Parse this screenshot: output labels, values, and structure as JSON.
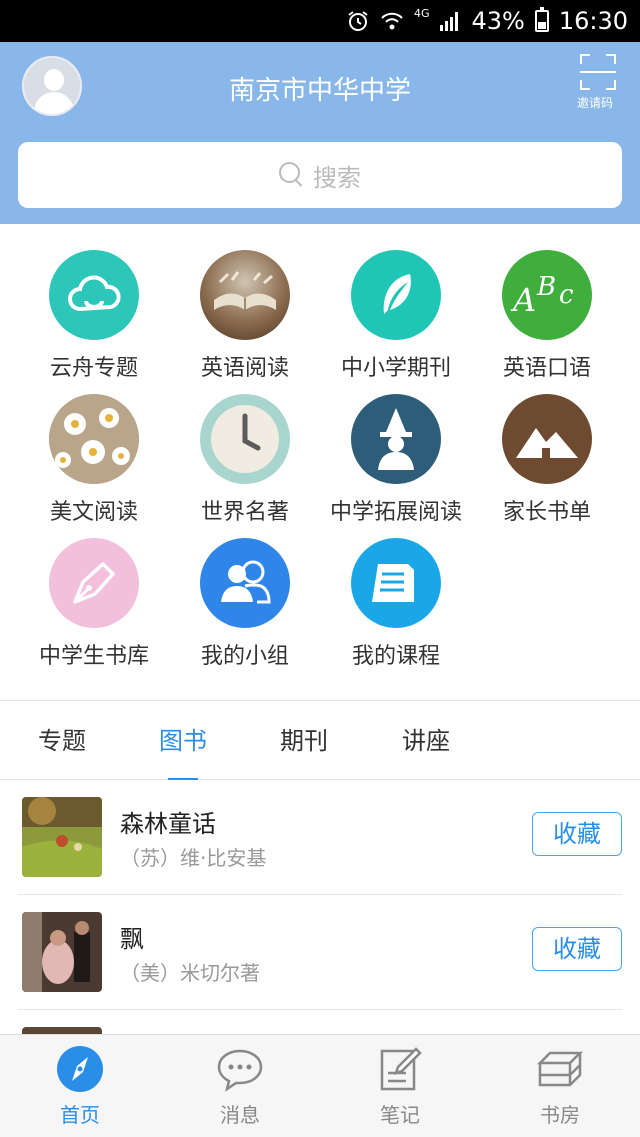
{
  "status_bar": {
    "network": "4G",
    "battery": "43%",
    "time": "16:30"
  },
  "header": {
    "title": "南京市中华中学",
    "invite_label": "邀请码",
    "search_placeholder": "搜索"
  },
  "grid": [
    {
      "label": "云舟专题",
      "icon": "cloud-icon",
      "color": "#2cc7b9"
    },
    {
      "label": "英语阅读",
      "icon": "open-book-icon",
      "color": "#6b4a2f"
    },
    {
      "label": "中小学期刊",
      "icon": "feather-icon",
      "color": "#1fc6b5"
    },
    {
      "label": "英语口语",
      "icon": "abc-icon",
      "color": "#3fae3c"
    },
    {
      "label": "美文阅读",
      "icon": "daisy-icon",
      "color": "#c9b89c"
    },
    {
      "label": "世界名著",
      "icon": "clock-icon",
      "color": "#a9d5cf"
    },
    {
      "label": "中学拓展阅读",
      "icon": "wizard-icon",
      "color": "#2d5d79"
    },
    {
      "label": "家长书单",
      "icon": "mountain-icon",
      "color": "#6e4b30"
    },
    {
      "label": "中学生书库",
      "icon": "pen-nib-icon",
      "color": "#f2bfdc"
    },
    {
      "label": "我的小组",
      "icon": "group-icon",
      "color": "#2f86e8"
    },
    {
      "label": "我的课程",
      "icon": "document-icon",
      "color": "#1aa7e8"
    }
  ],
  "tabs": [
    {
      "label": "专题",
      "active": false
    },
    {
      "label": "图书",
      "active": true
    },
    {
      "label": "期刊",
      "active": false
    },
    {
      "label": "讲座",
      "active": false
    }
  ],
  "books": [
    {
      "title": "森林童话",
      "author": "（苏）维·比安基",
      "button": "收藏"
    },
    {
      "title": "飘",
      "author": "（美）米切尔著",
      "button": "收藏"
    }
  ],
  "bottom_nav": [
    {
      "label": "首页",
      "icon": "compass-icon",
      "active": true
    },
    {
      "label": "消息",
      "icon": "chat-bubble-icon",
      "active": false
    },
    {
      "label": "笔记",
      "icon": "note-edit-icon",
      "active": false
    },
    {
      "label": "书房",
      "icon": "bookshelf-icon",
      "active": false
    }
  ],
  "colors": {
    "header_bg": "#89b7ea",
    "accent": "#2a8ee8"
  }
}
